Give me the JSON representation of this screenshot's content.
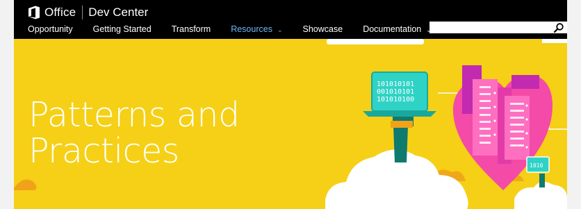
{
  "brand": {
    "office": "Office",
    "section": "Dev Center"
  },
  "nav": {
    "items": [
      {
        "label": "Opportunity",
        "active": false,
        "dropdown": false
      },
      {
        "label": "Getting Started",
        "active": false,
        "dropdown": false
      },
      {
        "label": "Transform",
        "active": false,
        "dropdown": false
      },
      {
        "label": "Resources",
        "active": true,
        "dropdown": true
      },
      {
        "label": "Showcase",
        "active": false,
        "dropdown": false
      },
      {
        "label": "Documentation",
        "active": false,
        "dropdown": true
      }
    ]
  },
  "search": {
    "value": "",
    "placeholder": "",
    "icon": "search-icon"
  },
  "hero": {
    "title_line1": "Patterns and",
    "title_line2": "Practices",
    "laptop_binary": [
      "101010101",
      "001010101",
      "101010100"
    ],
    "chip_text": "1010",
    "colors": {
      "background": "#f5d016",
      "heart": "#f44aa8",
      "teal": "#2fd3c5",
      "dark_teal": "#00776a"
    }
  },
  "colors": {
    "header_bg": "#000000",
    "active_nav": "#6cb6f2"
  }
}
